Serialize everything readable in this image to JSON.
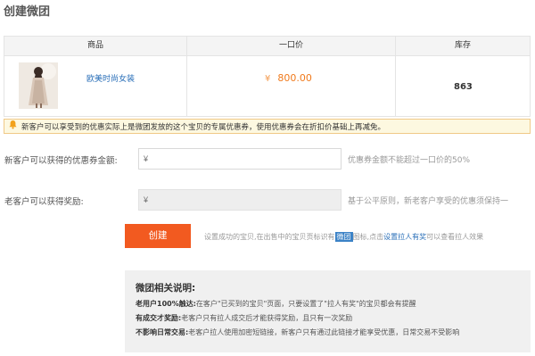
{
  "page_title": "创建微团",
  "table": {
    "headers": [
      "商品",
      "一口价",
      "库存"
    ],
    "product": {
      "name": "欧美时尚女装",
      "currency": "¥",
      "price": "800.00",
      "stock": "863"
    }
  },
  "notice": "新客户可以享受到的优惠实际上是微团发放的这个宝贝的专属优惠券，使用优惠券会在折扣价基础上再减免。",
  "new_customer": {
    "label": "新客户可以获得的优惠券金额:",
    "placeholder": "¥",
    "hint": "优惠券金额不能超过一口价的50%"
  },
  "old_customer": {
    "label": "老客户可以获得奖励:",
    "placeholder": "¥",
    "hint": "基于公平原则，新老客户享受的优惠须保持一"
  },
  "create": {
    "button": "创建",
    "hint_before": "设置成功的宝贝,在出售中的宝贝页标识有",
    "tag": "微团",
    "hint_middle": "图标,点击",
    "link": "设置拉人有奖",
    "hint_after": "可以查看拉人效果"
  },
  "info": {
    "title": "微团相关说明:",
    "lines": [
      {
        "bold": "老用户100%触达:",
        "text": "在客户\"已买到的宝贝\"页面，只要设置了\"拉人有奖\"的宝贝都会有提醒"
      },
      {
        "bold": "有成交才奖励:",
        "text": "老客户只有拉人成交后才能获得奖励，且只有一次奖励"
      },
      {
        "bold": "不影响日常交易:",
        "text": "老客户拉人使用加密短链接，新客户只有通过此链接才能享受优惠，日常交易不受影响"
      }
    ]
  },
  "colors": {
    "accent": "#f25a20",
    "price": "#f07a1c",
    "link": "#2a6fb8",
    "notice_bg": "#fdf8e0"
  }
}
